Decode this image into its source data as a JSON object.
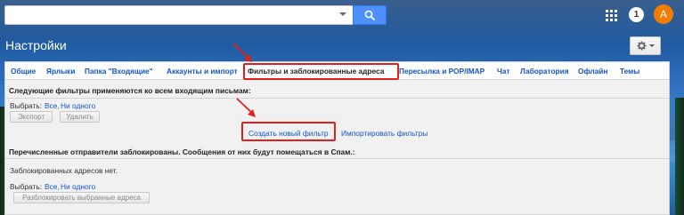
{
  "topbar": {
    "search_placeholder": "",
    "notification_count": "1",
    "avatar_letter": "A"
  },
  "settings": {
    "title": "Настройки"
  },
  "tabs": [
    {
      "label": "Общие",
      "active": false
    },
    {
      "label": "Ярлыки",
      "active": false
    },
    {
      "label": "Папка \"Входящие\"",
      "active": false
    },
    {
      "label": "Аккаунты и импорт",
      "active": false
    },
    {
      "label": "Фильтры и заблокированные адреса",
      "active": true
    },
    {
      "label": "Пересылка и POP/IMAP",
      "active": false
    },
    {
      "label": "Чат",
      "active": false
    },
    {
      "label": "Лаборатория",
      "active": false
    },
    {
      "label": "Офлайн",
      "active": false
    },
    {
      "label": "Темы",
      "active": false
    }
  ],
  "filters": {
    "heading": "Следующие фильтры применяются ко всем входящим письмам:",
    "select_label": "Выбрать:",
    "select_all": "Все,",
    "select_none": "Ни одного",
    "export_button": "Экспорт",
    "delete_button": "Удалить",
    "create_filter": "Создать новый фильтр",
    "import_filters": "Импортировать фильтры"
  },
  "blocked": {
    "heading": "Перечисленные отправители заблокированы. Сообщения от них будут помещаться в Спам.:",
    "empty_text": "Заблокированных адресов нет.",
    "select_label": "Выбрать:",
    "select_all": "Все,",
    "select_none": "Ни одного",
    "unblock_button": "Разблокировать выбранные адреса"
  },
  "colors": {
    "accent_blue": "#4d90fe",
    "link_blue": "#1155cc",
    "highlight_red": "#e0201b",
    "avatar_orange": "#f57c00"
  }
}
